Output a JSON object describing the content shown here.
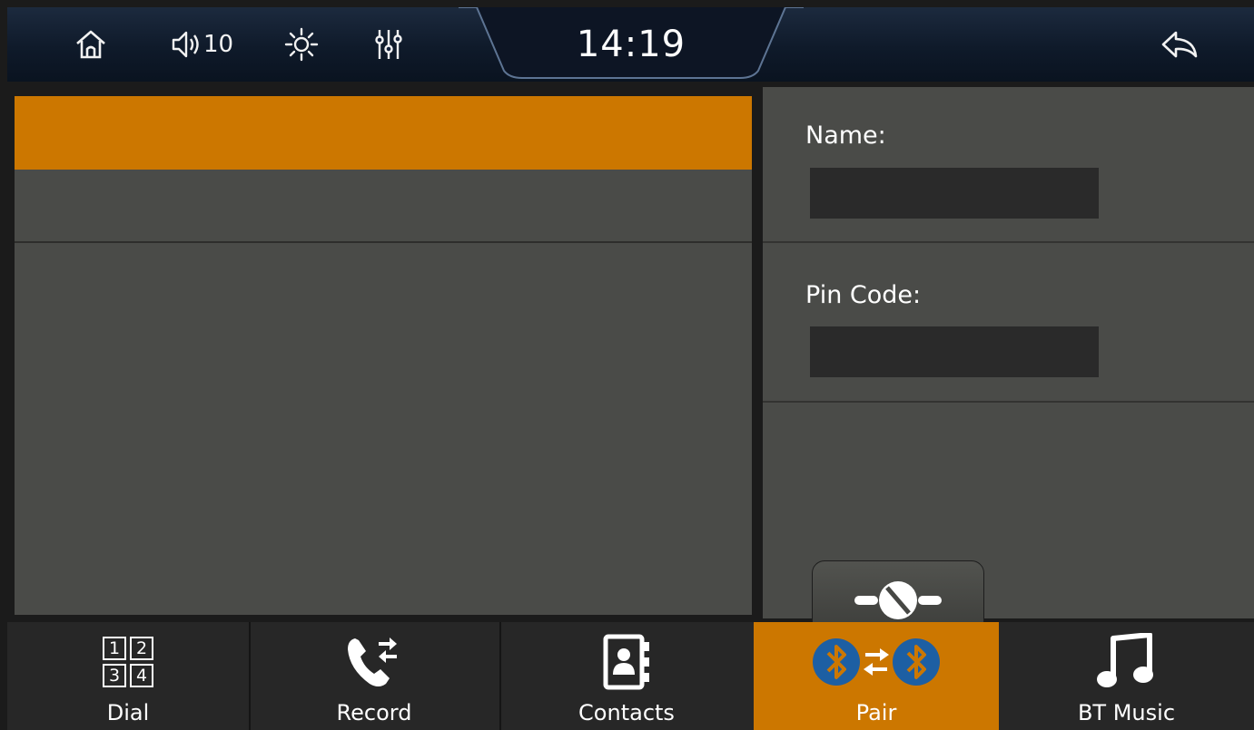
{
  "status_bar": {
    "volume": "10",
    "time": "14:19"
  },
  "device_list": {
    "items": [
      "",
      ""
    ]
  },
  "pair_panel": {
    "name_label": "Name:",
    "name_value": "",
    "pin_label": "Pin Code:",
    "pin_value": ""
  },
  "nav": {
    "dial": "Dial",
    "dial_keys": [
      "1",
      "2",
      "3",
      "4"
    ],
    "record": "Record",
    "contacts": "Contacts",
    "pair": "Pair",
    "bt_music": "BT Music"
  },
  "colors": {
    "accent": "#cc7700",
    "panel": "#4a4b48",
    "field": "#2a2a2a",
    "bluetooth_badge": "#1d5fa3"
  },
  "icons": [
    "home-icon",
    "speaker-icon",
    "brightness-icon",
    "equalizer-icon",
    "back-icon",
    "disconnect-plug-icon",
    "dial-pad-icon",
    "call-record-icon",
    "contacts-book-icon",
    "bluetooth-pair-icon",
    "music-note-icon"
  ]
}
